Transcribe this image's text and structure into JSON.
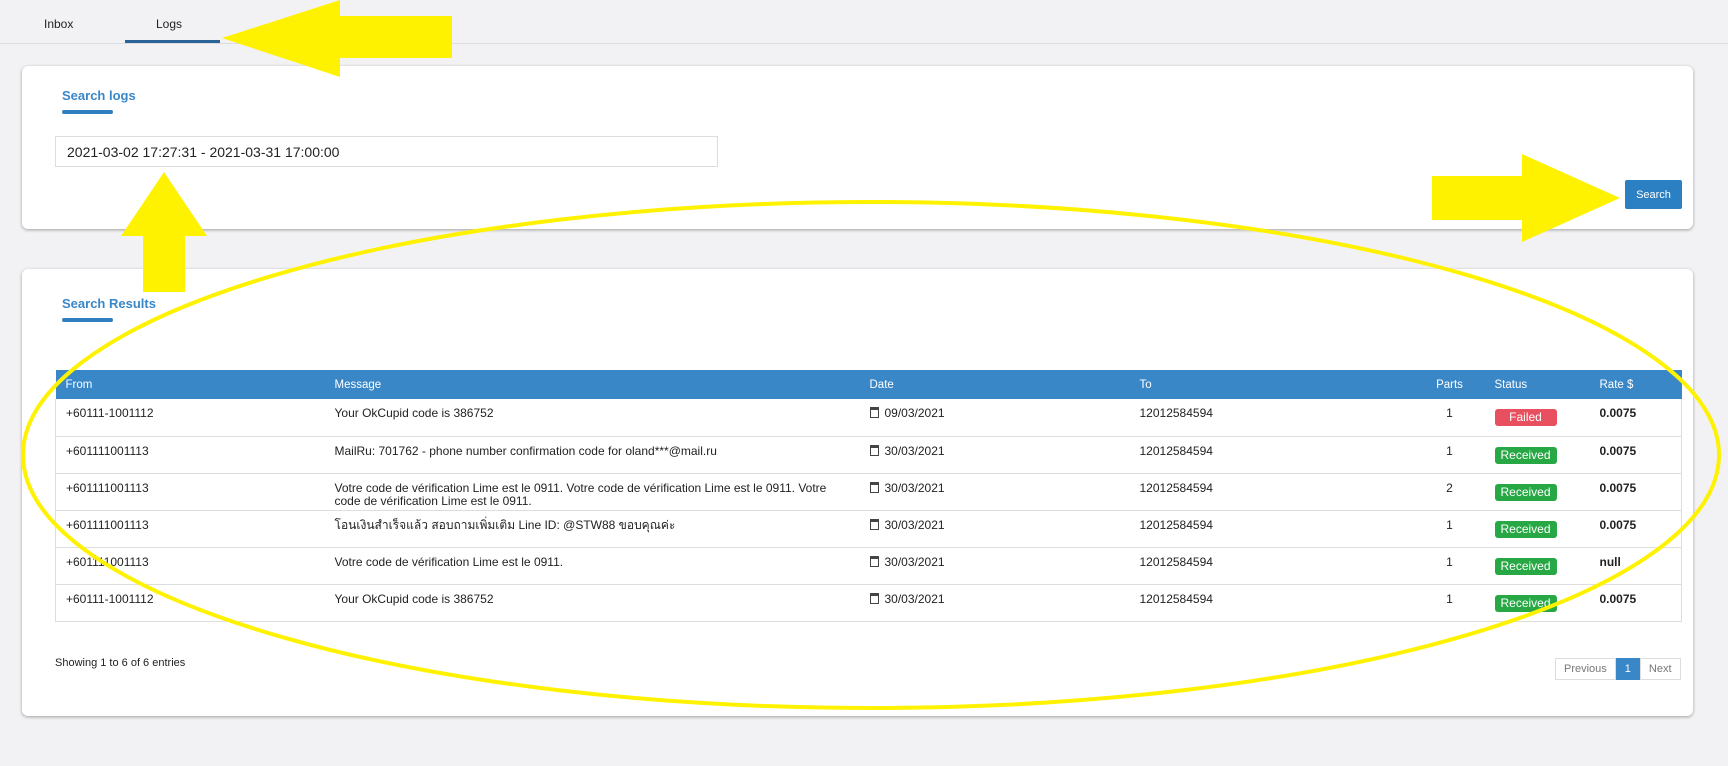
{
  "tabs": [
    {
      "label": "Inbox",
      "active": false
    },
    {
      "label": "Logs",
      "active": true
    }
  ],
  "search": {
    "title": "Search logs",
    "date_range": "2021-03-02 17:27:31 - 2021-03-31 17:00:00",
    "button": "Search"
  },
  "results": {
    "title": "Search Results",
    "columns": [
      "From",
      "Message",
      "Date",
      "To",
      "Parts",
      "Status",
      "Rate $"
    ],
    "rows": [
      {
        "from": "+60111-1001112",
        "message": "Your OkCupid code is 386752",
        "date": "09/03/2021",
        "to": "12012584594",
        "parts": "1",
        "status": "Failed",
        "rate": "0.0075"
      },
      {
        "from": "+601111001113",
        "message": "MailRu: 701762 - phone number confirmation code for oland***@mail.ru",
        "date": "30/03/2021",
        "to": "12012584594",
        "parts": "1",
        "status": "Received",
        "rate": "0.0075"
      },
      {
        "from": "+601111001113",
        "message": "Votre code de vérification Lime est le 0911. Votre code de vérification Lime est le 0911. Votre code de vérification Lime est le 0911.",
        "date": "30/03/2021",
        "to": "12012584594",
        "parts": "2",
        "status": "Received",
        "rate": "0.0075"
      },
      {
        "from": "+601111001113",
        "message": "โอนเงินสำเร็จแล้ว สอบถามเพิ่มเติม Line ID: @STW88 ขอบคุณค่ะ",
        "date": "30/03/2021",
        "to": "12012584594",
        "parts": "1",
        "status": "Received",
        "rate": "0.0075"
      },
      {
        "from": "+601111001113",
        "message": "Votre code de vérification Lime est le 0911.",
        "date": "30/03/2021",
        "to": "12012584594",
        "parts": "1",
        "status": "Received",
        "rate": "null"
      },
      {
        "from": "+60111-1001112",
        "message": "Your OkCupid code is 386752",
        "date": "30/03/2021",
        "to": "12012584594",
        "parts": "1",
        "status": "Received",
        "rate": "0.0075"
      }
    ],
    "showing": "Showing 1 to 6 of 6 entries",
    "pagination": {
      "previous": "Previous",
      "current": "1",
      "next": "Next"
    }
  },
  "colors": {
    "accent": "#3a87c8",
    "failed": "#e8505f",
    "received": "#28a745",
    "annotation": "#fff200"
  }
}
